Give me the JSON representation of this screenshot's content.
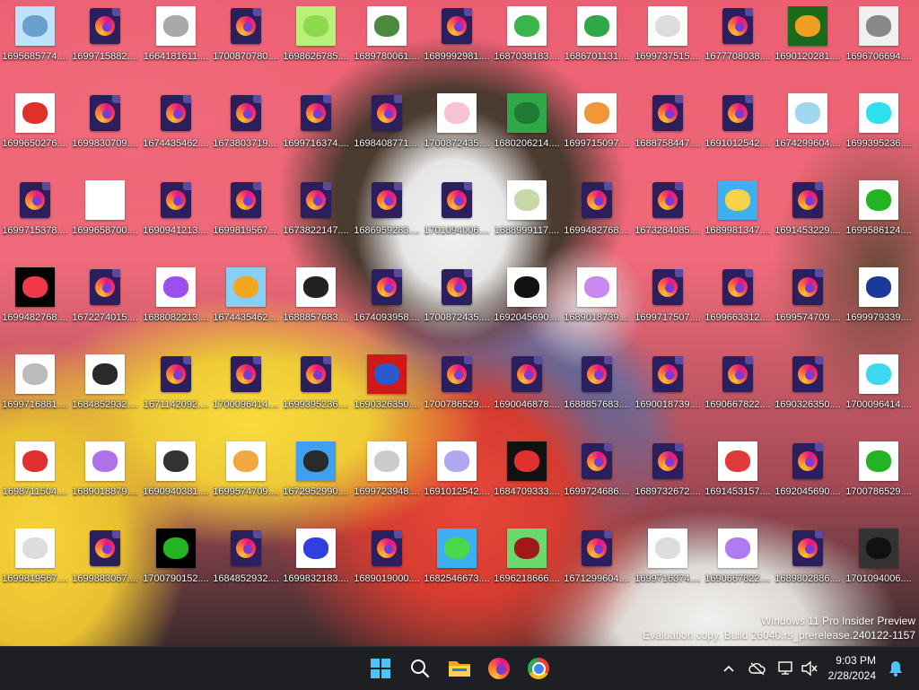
{
  "desktop_icons": [
    {
      "label": "1695685774....",
      "kind": "image",
      "colors": [
        "#bfe3ff",
        "#6aa0cc"
      ]
    },
    {
      "label": "1699715882....",
      "kind": "firefox"
    },
    {
      "label": "1664181611....",
      "kind": "image",
      "colors": [
        "#ffffff",
        "#a9a9a9"
      ]
    },
    {
      "label": "1700870780....",
      "kind": "firefox"
    },
    {
      "label": "1698626785....",
      "kind": "image",
      "colors": [
        "#b8f07a",
        "#8cd94e"
      ]
    },
    {
      "label": "1689780061....",
      "kind": "image",
      "colors": [
        "#ffffff",
        "#4a8a3a"
      ]
    },
    {
      "label": "1689992981....",
      "kind": "firefox"
    },
    {
      "label": "1687038183....",
      "kind": "image",
      "colors": [
        "#ffffff",
        "#3bb54a"
      ]
    },
    {
      "label": "1686701131....",
      "kind": "image",
      "colors": [
        "#ffffff",
        "#2fa84a"
      ]
    },
    {
      "label": "1699737515....",
      "kind": "image",
      "colors": [
        "#ffffff",
        "#dddddd"
      ]
    },
    {
      "label": "1677708038....",
      "kind": "firefox"
    },
    {
      "label": "1690120281....",
      "kind": "image",
      "colors": [
        "#1a6a1a",
        "#f0a020"
      ]
    },
    {
      "label": "1696706694....",
      "kind": "image",
      "colors": [
        "#f0f0f0",
        "#888888"
      ]
    },
    {
      "label": "1699650276....",
      "kind": "image",
      "colors": [
        "#ffffff",
        "#e0302a"
      ]
    },
    {
      "label": "1699830709....",
      "kind": "firefox"
    },
    {
      "label": "1674435462....",
      "kind": "firefox"
    },
    {
      "label": "1673803719....",
      "kind": "firefox"
    },
    {
      "label": "1699716374....",
      "kind": "firefox"
    },
    {
      "label": "1698408771....",
      "kind": "firefox"
    },
    {
      "label": "1700872435....",
      "kind": "image",
      "colors": [
        "#ffffff",
        "#f7c3d2"
      ]
    },
    {
      "label": "1680206214....",
      "kind": "image",
      "colors": [
        "#2fa84a",
        "#1f7a32"
      ]
    },
    {
      "label": "1699715097....",
      "kind": "image",
      "colors": [
        "#ffffff",
        "#f2963a"
      ]
    },
    {
      "label": "1688758447....",
      "kind": "firefox"
    },
    {
      "label": "1691012542....",
      "kind": "firefox"
    },
    {
      "label": "1674299604....",
      "kind": "image",
      "colors": [
        "#ffffff",
        "#9fd6f0"
      ]
    },
    {
      "label": "1699395236....",
      "kind": "image",
      "colors": [
        "#ffffff",
        "#2de0f0"
      ]
    },
    {
      "label": "1699715378....",
      "kind": "firefox"
    },
    {
      "label": "1699658700....",
      "kind": "image",
      "colors": [
        "#ffffff",
        "#ffffff"
      ]
    },
    {
      "label": "1690941213....",
      "kind": "firefox"
    },
    {
      "label": "1699819567....",
      "kind": "firefox"
    },
    {
      "label": "1673822147....",
      "kind": "firefox"
    },
    {
      "label": "1686959283....",
      "kind": "firefox"
    },
    {
      "label": "1701094006....",
      "kind": "firefox"
    },
    {
      "label": "1688999117....",
      "kind": "image",
      "colors": [
        "#ffffff",
        "#c8d8a8"
      ]
    },
    {
      "label": "1699482768....",
      "kind": "firefox"
    },
    {
      "label": "1673284085....",
      "kind": "firefox"
    },
    {
      "label": "1689981347....",
      "kind": "image",
      "colors": [
        "#3fb0ef",
        "#f4d24a"
      ]
    },
    {
      "label": "1691453229....",
      "kind": "firefox"
    },
    {
      "label": "1699586124....",
      "kind": "image",
      "colors": [
        "#ffffff",
        "#22b422"
      ]
    },
    {
      "label": "1699482768....",
      "kind": "image",
      "colors": [
        "#000000",
        "#f03a4a"
      ]
    },
    {
      "label": "1672274015....",
      "kind": "firefox"
    },
    {
      "label": "1688082213....",
      "kind": "image",
      "colors": [
        "#ffffff",
        "#9c4ef0"
      ]
    },
    {
      "label": "1674435462....",
      "kind": "image",
      "colors": [
        "#87d0f5",
        "#f2a81e"
      ]
    },
    {
      "label": "1688857683....",
      "kind": "image",
      "colors": [
        "#ffffff",
        "#222222"
      ]
    },
    {
      "label": "1674093958....",
      "kind": "firefox"
    },
    {
      "label": "1700872435....",
      "kind": "firefox"
    },
    {
      "label": "1692045690....",
      "kind": "image",
      "colors": [
        "#ffffff",
        "#111111"
      ]
    },
    {
      "label": "1689018739....",
      "kind": "image",
      "colors": [
        "#ffffff",
        "#c88af0"
      ]
    },
    {
      "label": "1699717507....",
      "kind": "firefox"
    },
    {
      "label": "1699663312....",
      "kind": "firefox"
    },
    {
      "label": "1699574709....",
      "kind": "firefox"
    },
    {
      "label": "1699979339....",
      "kind": "image",
      "colors": [
        "#ffffff",
        "#1a3a9a"
      ]
    },
    {
      "label": "1699716881....",
      "kind": "image",
      "colors": [
        "#ffffff",
        "#bbbbbb"
      ]
    },
    {
      "label": "1684852932....",
      "kind": "image",
      "colors": [
        "#ffffff",
        "#2a2a2a"
      ]
    },
    {
      "label": "1671142092....",
      "kind": "firefox"
    },
    {
      "label": "1700096414....",
      "kind": "firefox"
    },
    {
      "label": "1699395236....",
      "kind": "firefox"
    },
    {
      "label": "1690326350....",
      "kind": "image",
      "colors": [
        "#d01818",
        "#2a5ad0"
      ]
    },
    {
      "label": "1700786529....",
      "kind": "firefox"
    },
    {
      "label": "1690046878....",
      "kind": "firefox"
    },
    {
      "label": "1688857683....",
      "kind": "firefox"
    },
    {
      "label": "1690018739....",
      "kind": "firefox"
    },
    {
      "label": "1690667822....",
      "kind": "firefox"
    },
    {
      "label": "1690326350....",
      "kind": "firefox"
    },
    {
      "label": "1700096414....",
      "kind": "image",
      "colors": [
        "#ffffff",
        "#3ed8f0"
      ]
    },
    {
      "label": "1698711504....",
      "kind": "image",
      "colors": [
        "#ffffff",
        "#e03030"
      ]
    },
    {
      "label": "1689018879....",
      "kind": "image",
      "colors": [
        "#ffffff",
        "#b070e8"
      ]
    },
    {
      "label": "1690940381....",
      "kind": "image",
      "colors": [
        "#ffffff",
        "#333333"
      ]
    },
    {
      "label": "1699574709....",
      "kind": "image",
      "colors": [
        "#ffffff",
        "#f2a840"
      ]
    },
    {
      "label": "1672952990....",
      "kind": "image",
      "colors": [
        "#3fa0ef",
        "#2a2a2a"
      ]
    },
    {
      "label": "1699723948....",
      "kind": "image",
      "colors": [
        "#ffffff",
        "#cccccc"
      ]
    },
    {
      "label": "1691012542....",
      "kind": "image",
      "colors": [
        "#ffffff",
        "#b0a8f0"
      ]
    },
    {
      "label": "1684709333....",
      "kind": "image",
      "colors": [
        "#111111",
        "#e03030"
      ]
    },
    {
      "label": "1699724686....",
      "kind": "firefox"
    },
    {
      "label": "1689732672....",
      "kind": "firefox"
    },
    {
      "label": "1691453157....",
      "kind": "image",
      "colors": [
        "#ffffff",
        "#e03a3a"
      ]
    },
    {
      "label": "1692045690....",
      "kind": "firefox"
    },
    {
      "label": "1700786529....",
      "kind": "image",
      "colors": [
        "#ffffff",
        "#22b422"
      ]
    },
    {
      "label": "1699819567....",
      "kind": "image",
      "colors": [
        "#ffffff",
        "#dddddd"
      ]
    },
    {
      "label": "1699883067....",
      "kind": "firefox"
    },
    {
      "label": "1700790152....",
      "kind": "image",
      "colors": [
        "#000000",
        "#22b422"
      ]
    },
    {
      "label": "1684852932....",
      "kind": "firefox"
    },
    {
      "label": "1699832183....",
      "kind": "image",
      "colors": [
        "#ffffff",
        "#3040e0"
      ]
    },
    {
      "label": "1689019000....",
      "kind": "firefox"
    },
    {
      "label": "1682546673....",
      "kind": "image",
      "colors": [
        "#3fb0ef",
        "#4ad84a"
      ]
    },
    {
      "label": "1696218666....",
      "kind": "image",
      "colors": [
        "#6ad86a",
        "#a01818"
      ]
    },
    {
      "label": "1671299604....",
      "kind": "firefox"
    },
    {
      "label": "1699716374....",
      "kind": "image",
      "colors": [
        "#ffffff",
        "#dddddd"
      ]
    },
    {
      "label": "1690667822....",
      "kind": "image",
      "colors": [
        "#ffffff",
        "#b07af0"
      ]
    },
    {
      "label": "1689802886....",
      "kind": "firefox"
    },
    {
      "label": "1701094006....",
      "kind": "image",
      "colors": [
        "#333333",
        "#111111"
      ]
    }
  ],
  "watermark": {
    "line1": "Windows 11 Pro Insider Preview",
    "line2": "Evaluation copy. Build 26040.rs_prerelease.240122-1157"
  },
  "taskbar": {
    "pinned": [
      {
        "name": "start",
        "icon": "windows-start-icon"
      },
      {
        "name": "search",
        "icon": "search-icon"
      },
      {
        "name": "file-explorer",
        "icon": "file-explorer-icon"
      },
      {
        "name": "firefox",
        "icon": "firefox-icon"
      },
      {
        "name": "chrome",
        "icon": "chrome-icon"
      }
    ],
    "tray_icons": [
      "chevron-up-icon",
      "onedrive-offline-icon",
      "network-icon",
      "volume-muted-icon"
    ],
    "time": "9:03 PM",
    "date": "2/28/2024",
    "accent": "#4cc2ff"
  }
}
